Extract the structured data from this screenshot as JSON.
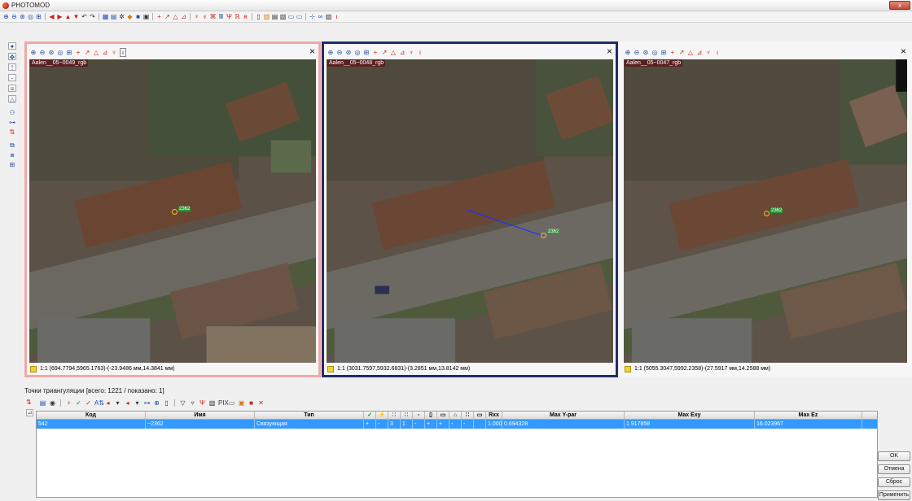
{
  "app": {
    "title": "PHOTOMOD",
    "close_label": "x"
  },
  "toolbar_icons": [
    "zoom-in-icon",
    "zoom-out-icon",
    "zoom-fit-icon",
    "zoom-window-icon",
    "grid-icon",
    "arrow-left-icon",
    "arrow-right-icon",
    "arrow-up-icon",
    "arrow-down-icon",
    "undo-icon",
    "redo-icon",
    "layers-icon",
    "export-icon",
    "tools-icon",
    "marker-icon",
    "stack-icon",
    "save-icon",
    "add-point-icon",
    "move-point-icon",
    "select-icon",
    "delete-point-icon",
    "cut-icon",
    "link-icon",
    "measure-icon",
    "text-icon",
    "page-icon",
    "table-icon",
    "list-icon",
    "view-icon",
    "window-icon",
    "panel-icon",
    "points-icon",
    "stats-icon",
    "info-icon"
  ],
  "panels": [
    {
      "image_name": "Aalen__05~0049_rgb",
      "status": "1:1 (694.7794,5965.1763)-(-23.9486 мм,14.3841 мм)",
      "marker_label": "2362",
      "accent": "#f0a0a0"
    },
    {
      "image_name": "Aalen__05~0048_rgb",
      "status": "1:1 (3031.7597,5932.6831)-(3.2851 мм,13.8142 мм)",
      "marker_label": "2362",
      "accent": "#1f2d6a"
    },
    {
      "image_name": "Aalen__05~0047_rgb",
      "status": "1:1 (5055.3047,5992.2358)-(27.5917 мм,14.2588 мм)",
      "marker_label": "2362",
      "accent": ""
    }
  ],
  "points": {
    "title": "Точки триангуляции [всего: 1221 / показано: 1]",
    "columns": [
      "Код",
      "Имя",
      "Тип",
      "",
      "",
      "",
      "",
      "",
      "",
      "",
      "",
      "",
      "",
      "Rxx",
      "Max Y-par",
      "Max Exy",
      "Max Ez"
    ],
    "row": [
      "542",
      "~2362",
      "Связующая",
      "+",
      "-",
      "3",
      "1",
      "-",
      "+",
      "+",
      "-",
      "-",
      "",
      "1.000",
      "0.694328",
      "1.917858",
      "16.023967"
    ]
  },
  "buttons": {
    "ok": "OK",
    "cancel": "Отмена",
    "reset": "Сброс",
    "apply": "Применить"
  }
}
